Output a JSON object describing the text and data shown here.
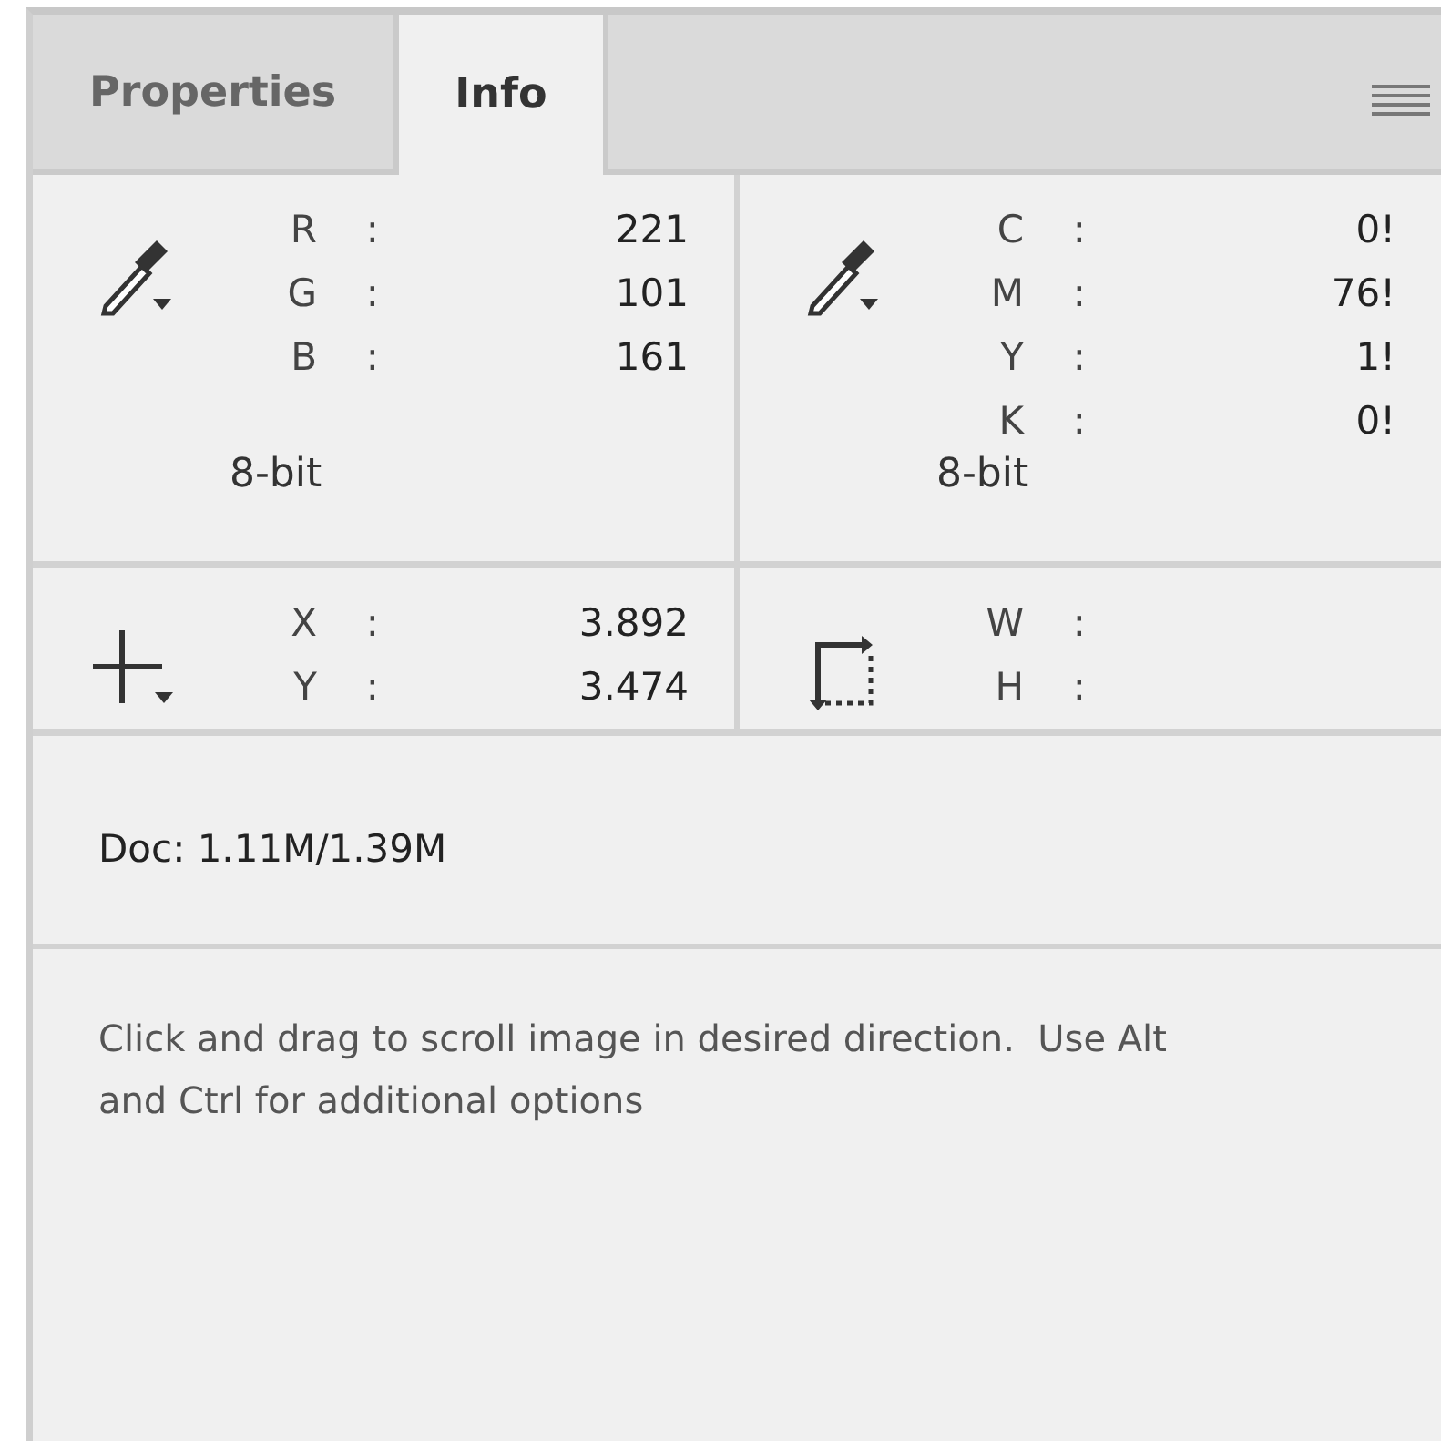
{
  "tabs": [
    {
      "label": "Properties",
      "selected": false
    },
    {
      "label": "Info",
      "selected": true
    }
  ],
  "color_readouts": [
    {
      "kind": "eyedropper",
      "channels": [
        {
          "label": "R",
          "separator": ":",
          "value": "221"
        },
        {
          "label": "G",
          "separator": ":",
          "value": "101"
        },
        {
          "label": "B",
          "separator": ":",
          "value": "161"
        }
      ],
      "depth": "8-bit"
    },
    {
      "kind": "eyedropper",
      "channels": [
        {
          "label": "C",
          "separator": ":",
          "value": "0!"
        },
        {
          "label": "M",
          "separator": ":",
          "value": "76!"
        },
        {
          "label": "Y",
          "separator": ":",
          "value": "1!"
        },
        {
          "label": "K",
          "separator": ":",
          "value": "0!"
        }
      ],
      "depth": "8-bit"
    }
  ],
  "geometry_readouts": [
    {
      "kind": "crosshair",
      "channels": [
        {
          "label": "X",
          "separator": ":",
          "value": "3.892"
        },
        {
          "label": "Y",
          "separator": ":",
          "value": "3.474"
        }
      ]
    },
    {
      "kind": "size",
      "channels": [
        {
          "label": "W",
          "separator": ":"
        },
        {
          "label": "H",
          "separator": ":"
        }
      ]
    }
  ],
  "doc_size": "Doc: 1.11M/1.39M",
  "hint": "Click and drag to scroll image in desired direction.  Use Alt and Ctrl for additional options"
}
